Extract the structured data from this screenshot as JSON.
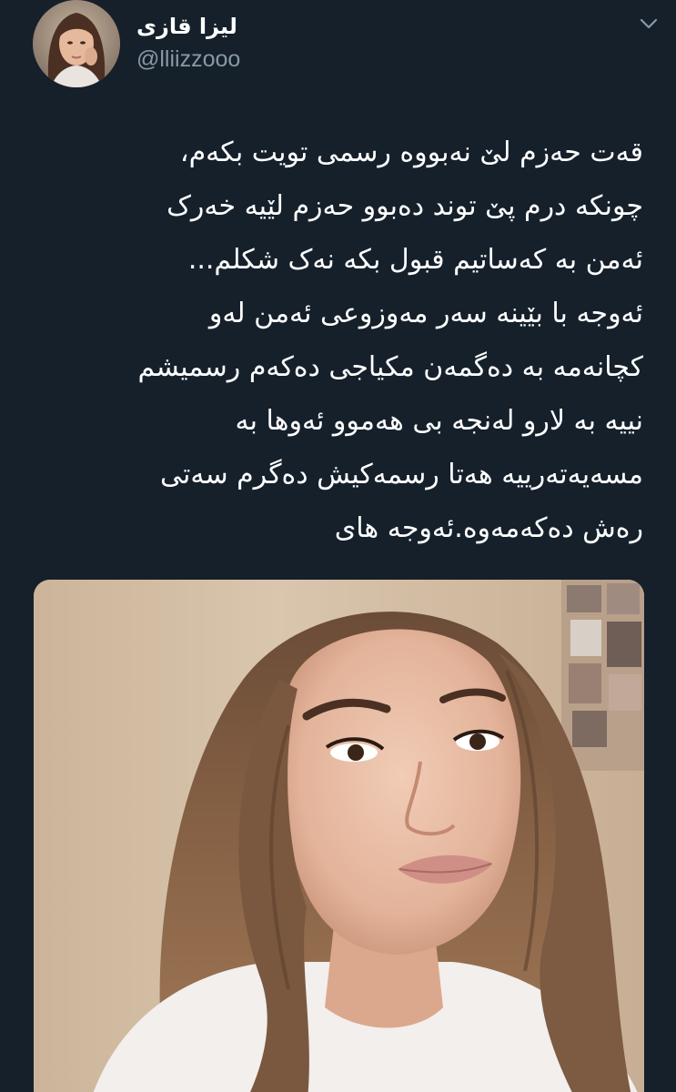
{
  "author": {
    "display_name": "ليزا قازى",
    "handle": "@lliizzooo"
  },
  "menu": {
    "icon": "chevron-down-icon"
  },
  "tweet": {
    "lines": [
      "قەت حەزم لێ نەبووە رسمی تویت بکەم،",
      "چونکە درم پێ توند دەبوو حەزم لێیە خەرک",
      "ئەمن بە کەساتیم قبول بکە نەک شکلم...",
      "ئەوجە با بێینە سەر مەوزوعی ئەمن لەو",
      "کچانەمە بە دەگمەن مکیاجی دەکەم رسمیشم",
      "نییە بە لارو لەنجە بی هەموو ئەوها بە",
      "مسەیەتەرییە هەتا رسمەکیش دەگرم سەتی",
      "رەش دەکەمەوە.ئەوجە های"
    ]
  },
  "media": {
    "type": "photo"
  },
  "colors": {
    "background": "#15202b",
    "secondary_text": "#8899a6",
    "primary_text": "#ffffff"
  }
}
